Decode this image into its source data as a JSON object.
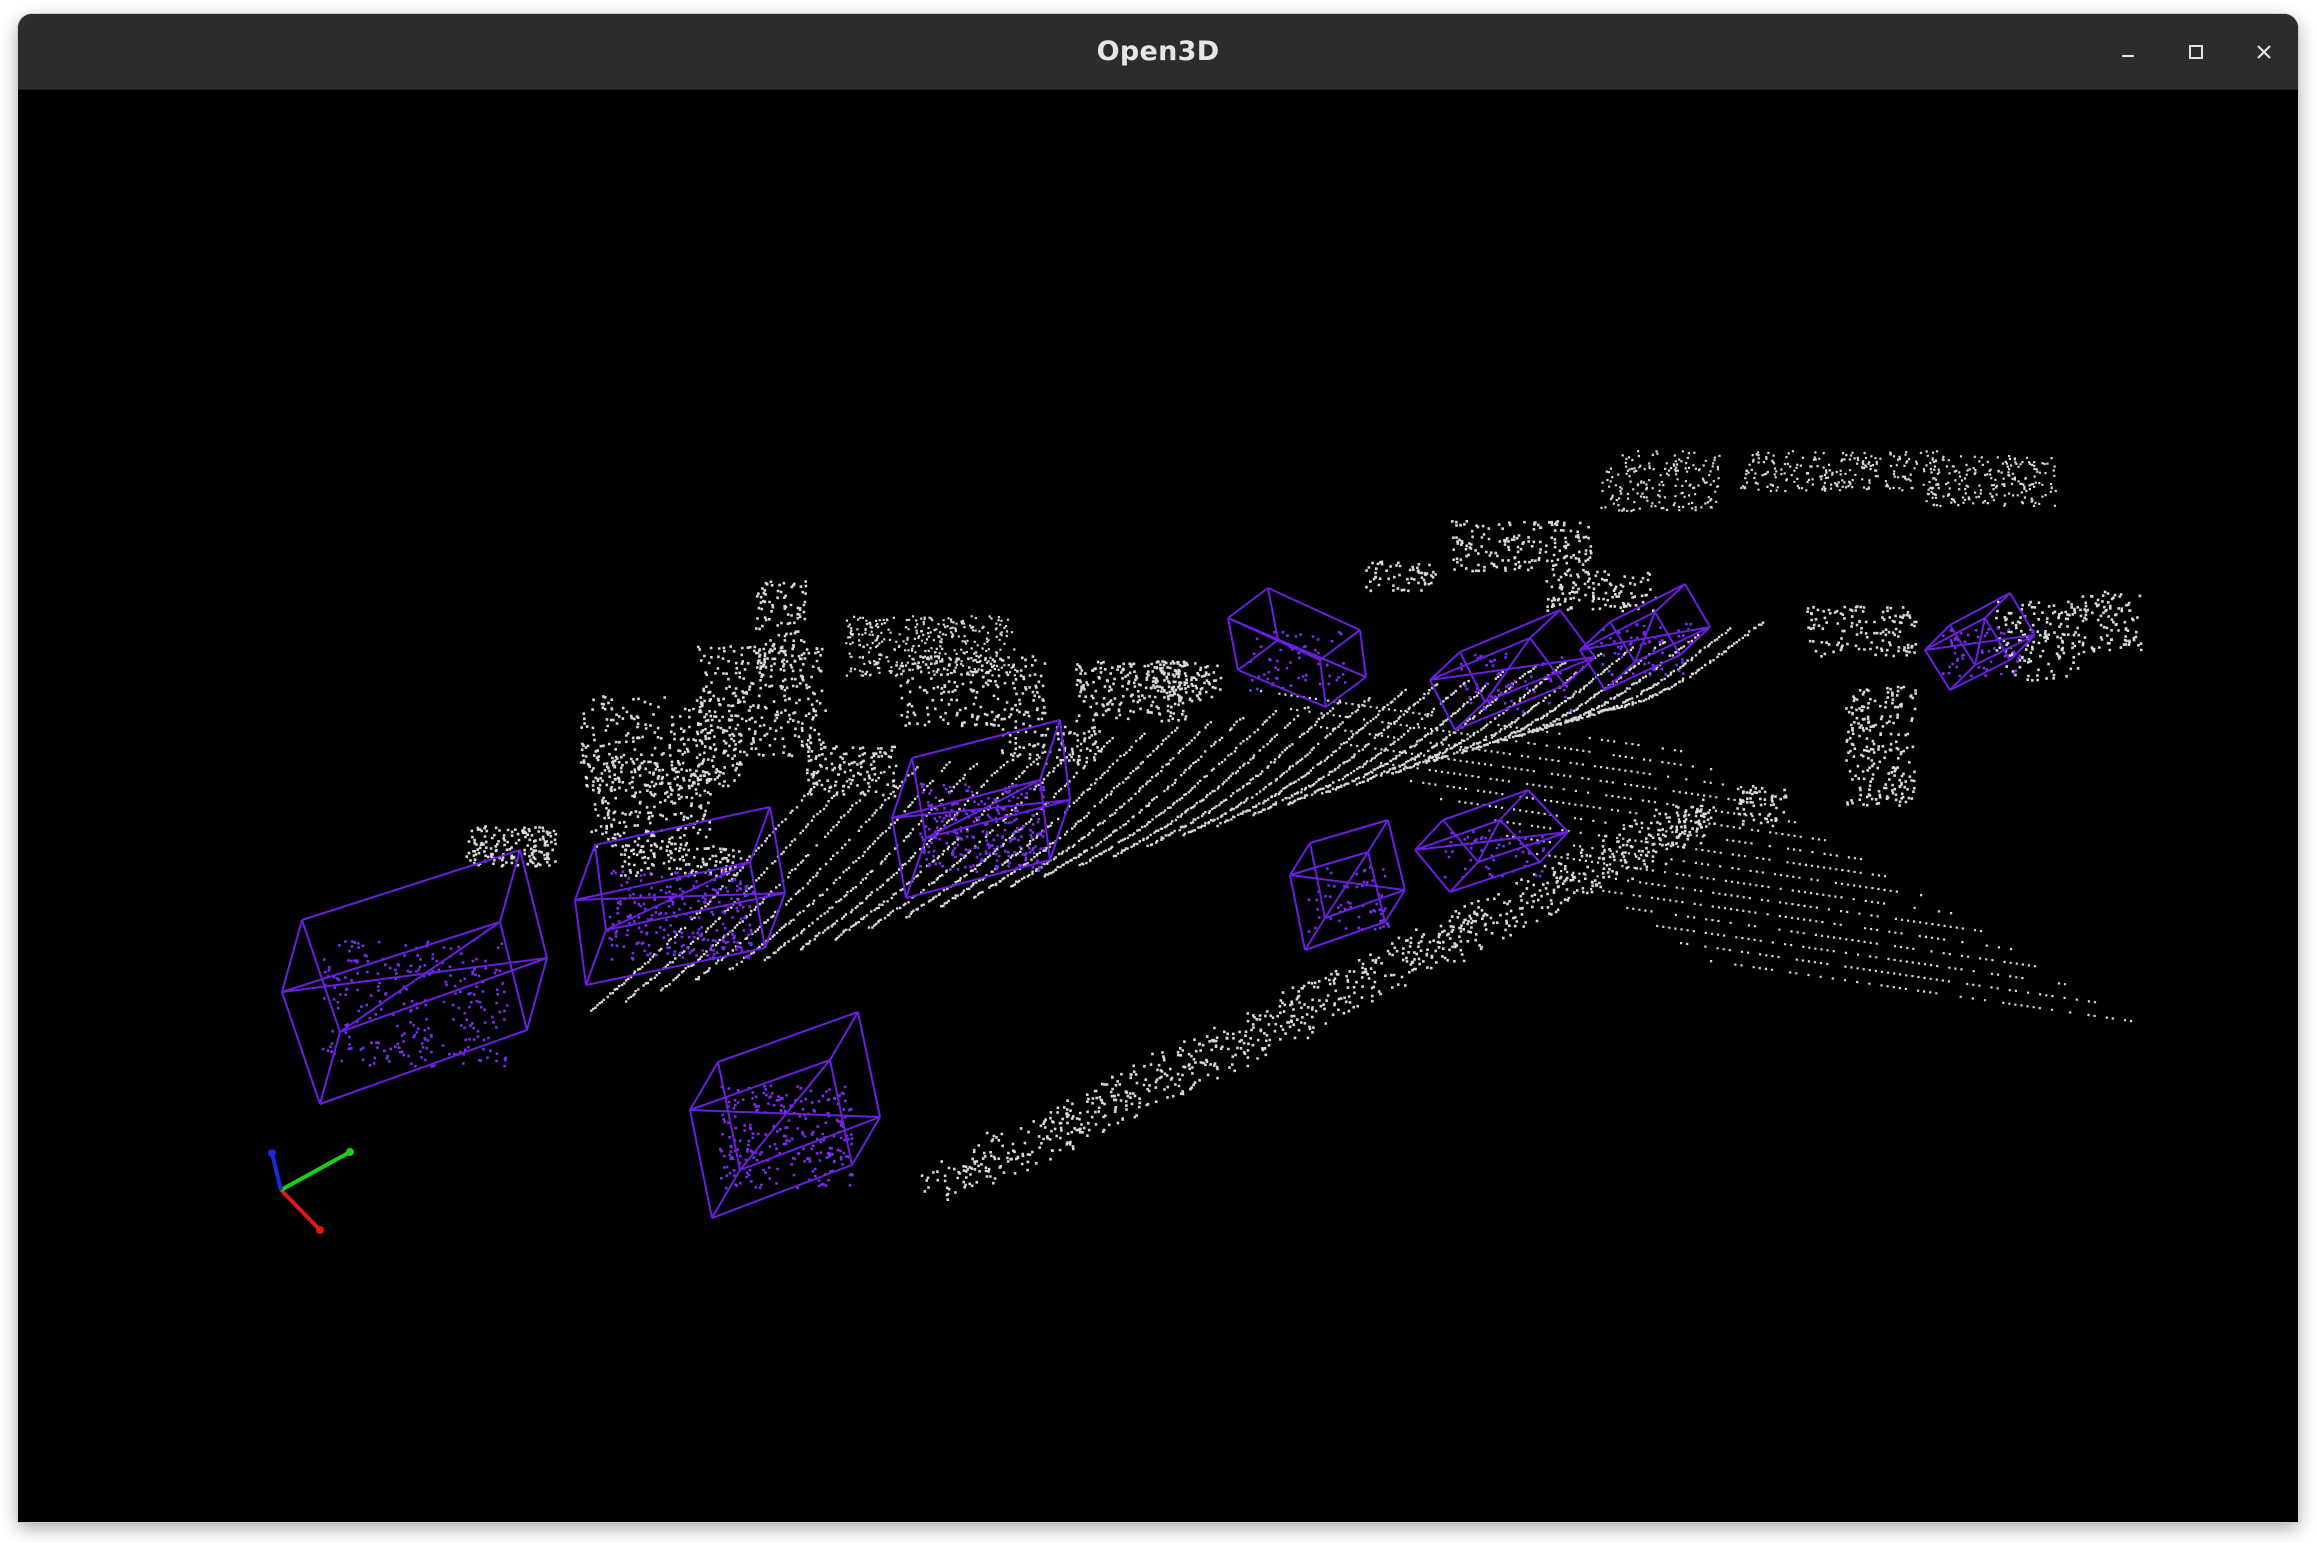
{
  "window": {
    "title": "Open3D",
    "controls": [
      "minimize",
      "maximize",
      "close"
    ]
  },
  "colors": {
    "titlebar_bg": "#2c2c2c",
    "title_text": "#e6e6e6",
    "viewport_bg": "#000000",
    "point_default": "#d9d9d9",
    "bounding_box": "#6a1fe0",
    "points_in_box": "#7a2cf0",
    "axis_x": "#e01818",
    "axis_y": "#18d018",
    "axis_z": "#1b2ad8"
  },
  "scene": {
    "type": "lidar-point-cloud",
    "bounding_box_count": 10,
    "coordinate_frame_axes": [
      "x",
      "y",
      "z"
    ]
  }
}
